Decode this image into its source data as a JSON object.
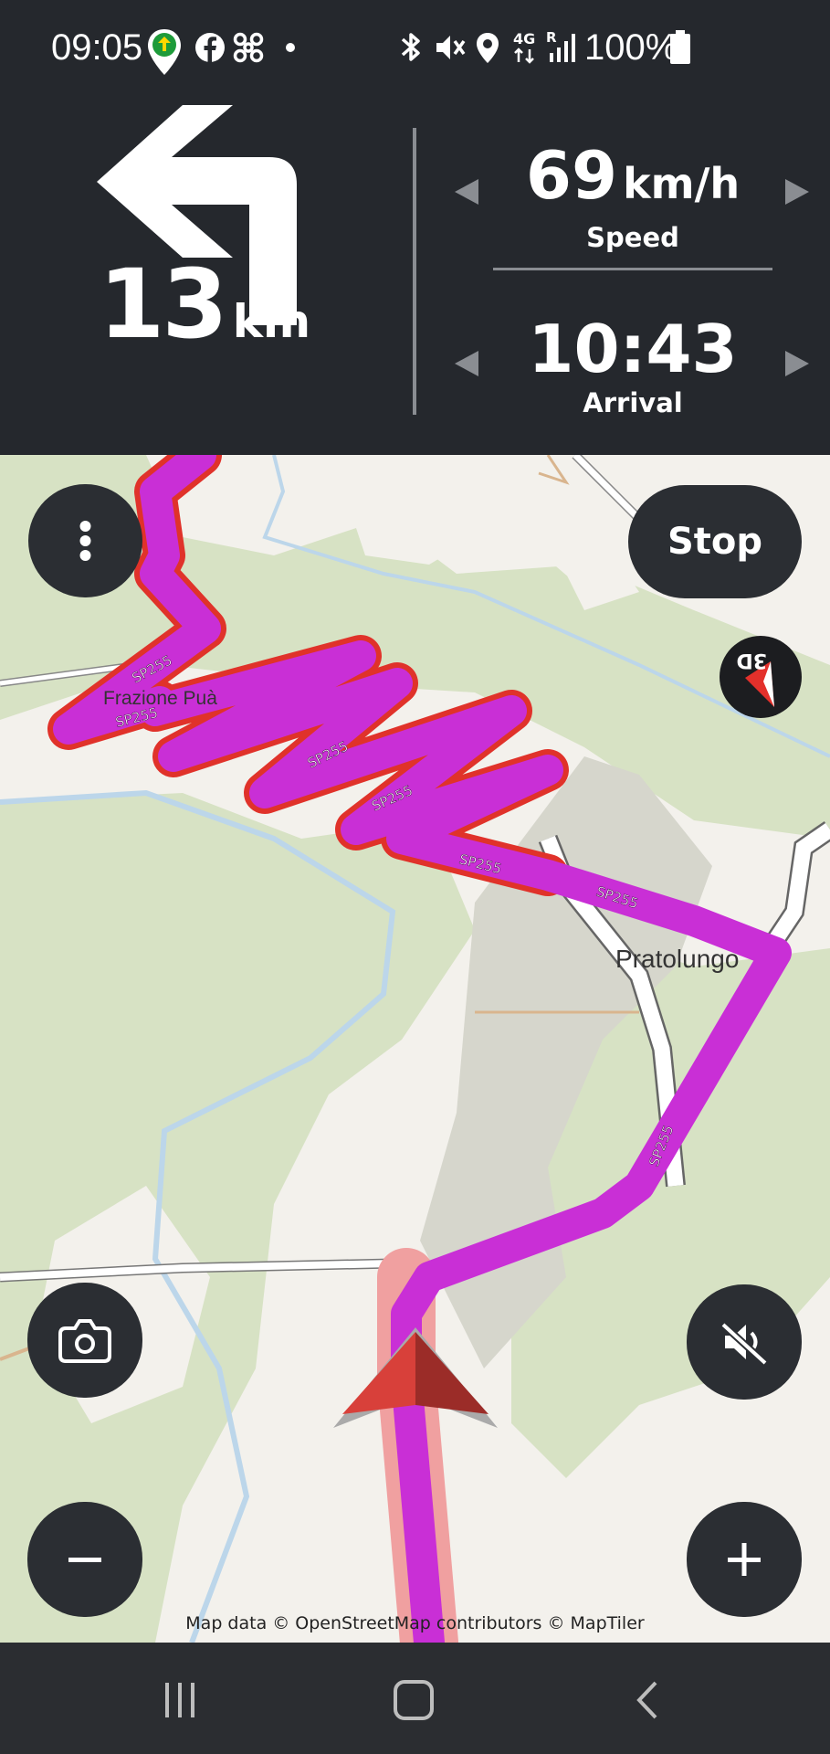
{
  "status_bar": {
    "time": "09:05",
    "battery_percent": "100%",
    "icons": [
      "app-notification-icon",
      "facebook-icon",
      "fan-icon",
      "dot-icon",
      "bluetooth-icon",
      "mute-icon",
      "location-icon",
      "4g-icon",
      "signal-icon",
      "battery-icon"
    ]
  },
  "navigation": {
    "turn_icon": "turn-left-icon",
    "turn_distance_value": "13",
    "turn_distance_unit": "km",
    "speed_value": "69",
    "speed_unit": "km/h",
    "speed_label": "Speed",
    "arrival_value": "10:43",
    "arrival_label": "Arrival"
  },
  "map": {
    "place_labels": [
      "Frazione Puà",
      "Pratolungo"
    ],
    "road_labels": [
      "SP255",
      "SP255",
      "SP255",
      "SP255",
      "SP255",
      "SP255",
      "SP255"
    ],
    "attribution": "Map data © OpenStreetMap contributors © MapTiler",
    "compass_label": "3D",
    "route_color": "#c92fd6",
    "route_outline_color": "#e0322a",
    "traveled_color": "#f0a0a0"
  },
  "controls": {
    "menu_icon": "more-vert-icon",
    "stop_label": "Stop",
    "camera_icon": "camera-icon",
    "mute_icon": "volume-off-icon",
    "zoom_out_icon": "minus-icon",
    "zoom_in_icon": "plus-icon"
  },
  "system_nav": {
    "recents_icon": "recents-icon",
    "home_icon": "home-icon",
    "back_icon": "back-icon"
  }
}
